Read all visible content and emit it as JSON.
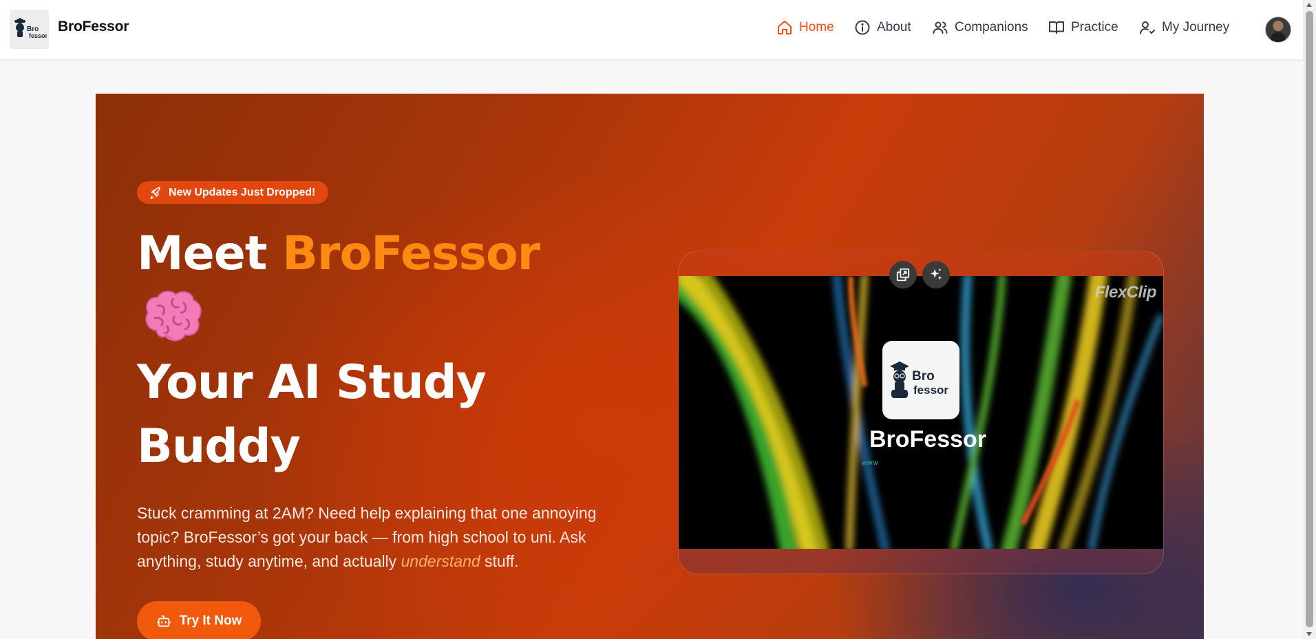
{
  "header": {
    "brand": "BroFessor",
    "logo_text_1": "Bro",
    "logo_text_2": "fessor",
    "nav": [
      {
        "label": "Home",
        "icon": "home-icon",
        "active": true
      },
      {
        "label": "About",
        "icon": "info-icon",
        "active": false
      },
      {
        "label": "Companions",
        "icon": "users-icon",
        "active": false
      },
      {
        "label": "Practice",
        "icon": "book-open-icon",
        "active": false
      },
      {
        "label": "My Journey",
        "icon": "user-check-icon",
        "active": false
      }
    ]
  },
  "hero": {
    "badge": "New Updates Just Dropped!",
    "headline_part1": "Meet ",
    "headline_accent": "BroFessor",
    "headline_line2": "Your AI Study",
    "headline_line3": "Buddy",
    "paragraph_main": "Stuck cramming at 2AM? Need help explaining that one annoying topic? BroFessor’s got your back — from high school to uni. Ask anything, study anytime, and actually ",
    "paragraph_em": "understand",
    "paragraph_end": " stuff.",
    "cta_label": "Try It Now"
  },
  "video": {
    "watermark": "FlexClip",
    "title": "BroFessor",
    "url_text": "www",
    "logo_text_1": "Bro",
    "logo_text_2": "fessor"
  },
  "colors": {
    "accent": "#f04d12",
    "headline_accent": "#ff8a12",
    "cta": "#f15a0c"
  }
}
